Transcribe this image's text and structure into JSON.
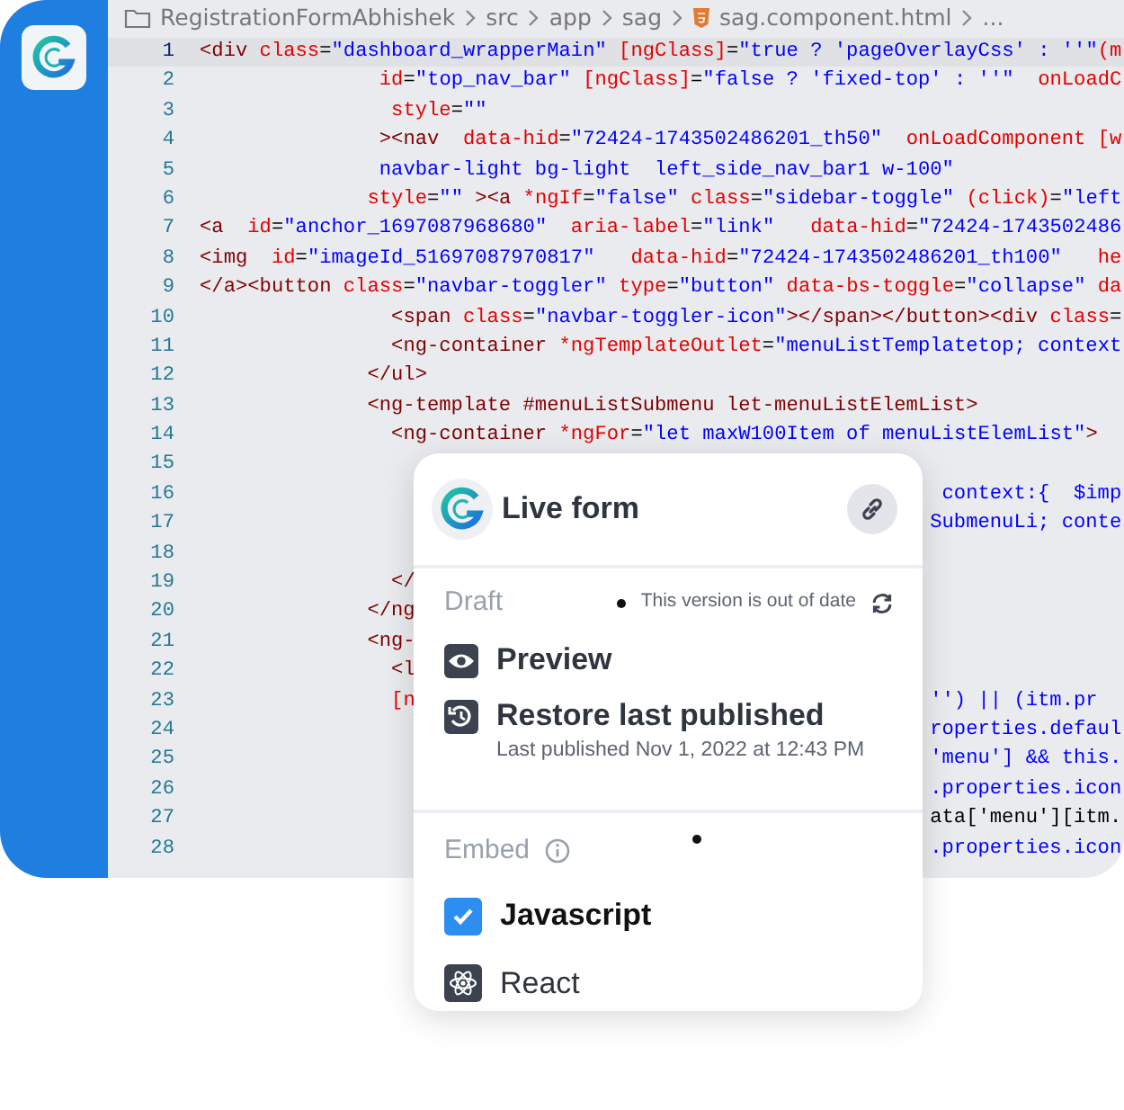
{
  "breadcrumb": [
    {
      "label": "RegistrationFormAbhishek",
      "kind": "folder"
    },
    {
      "label": "src"
    },
    {
      "label": "app"
    },
    {
      "label": "sag"
    },
    {
      "label": "sag.component.html",
      "kind": "html"
    },
    {
      "label": "..."
    }
  ],
  "editor": {
    "lines": [
      {
        "number": "1",
        "current": true,
        "tokens": [
          {
            "kind": "tag",
            "text": "<div "
          },
          {
            "kind": "attr",
            "text": "class"
          },
          {
            "kind": "plain",
            "text": "="
          },
          {
            "kind": "str",
            "text": "\"dashboard_wrapperMain\" "
          },
          {
            "kind": "attr",
            "text": "[ngClass]"
          },
          {
            "kind": "plain",
            "text": "="
          },
          {
            "kind": "str",
            "text": "\"true ? 'pageOverlayCss' : ''\""
          },
          {
            "kind": "attr",
            "text": "(m"
          }
        ]
      },
      {
        "number": "2",
        "current": false,
        "tokens": [
          {
            "kind": "attr",
            "text": "               id"
          },
          {
            "kind": "plain",
            "text": "="
          },
          {
            "kind": "str",
            "text": "\"top_nav_bar\" "
          },
          {
            "kind": "attr",
            "text": "[ngClass]"
          },
          {
            "kind": "plain",
            "text": "="
          },
          {
            "kind": "str",
            "text": "\"false ? 'fixed-top' : ''\"  "
          },
          {
            "kind": "attr",
            "text": "onLoadC"
          }
        ]
      },
      {
        "number": "3",
        "current": false,
        "tokens": [
          {
            "kind": "attr",
            "text": "                style"
          },
          {
            "kind": "plain",
            "text": "="
          },
          {
            "kind": "str",
            "text": "\"\""
          }
        ]
      },
      {
        "number": "4",
        "current": false,
        "tokens": [
          {
            "kind": "tag",
            "text": "               ><nav  "
          },
          {
            "kind": "attr",
            "text": "data-hid"
          },
          {
            "kind": "plain",
            "text": "="
          },
          {
            "kind": "str",
            "text": "\"72424-1743502486201_th50\"  "
          },
          {
            "kind": "attr",
            "text": "onLoadComponent [w"
          }
        ]
      },
      {
        "number": "5",
        "current": false,
        "tokens": [
          {
            "kind": "str",
            "text": "               navbar-light bg-light  left_side_nav_bar1 w-100\""
          }
        ]
      },
      {
        "number": "6",
        "current": false,
        "tokens": [
          {
            "kind": "attr",
            "text": "              style"
          },
          {
            "kind": "plain",
            "text": "="
          },
          {
            "kind": "str",
            "text": "\"\" "
          },
          {
            "kind": "tag",
            "text": "><a "
          },
          {
            "kind": "attr",
            "text": "*ngIf"
          },
          {
            "kind": "plain",
            "text": "="
          },
          {
            "kind": "str",
            "text": "\"false\" "
          },
          {
            "kind": "attr",
            "text": "class"
          },
          {
            "kind": "plain",
            "text": "="
          },
          {
            "kind": "str",
            "text": "\"sidebar-toggle\" "
          },
          {
            "kind": "attr",
            "text": "(click)"
          },
          {
            "kind": "plain",
            "text": "="
          },
          {
            "kind": "str",
            "text": "\"left"
          }
        ]
      },
      {
        "number": "7",
        "current": false,
        "tokens": [
          {
            "kind": "tag",
            "text": "<a  "
          },
          {
            "kind": "attr",
            "text": "id"
          },
          {
            "kind": "plain",
            "text": "="
          },
          {
            "kind": "str",
            "text": "\"anchor_1697087968680\"  "
          },
          {
            "kind": "attr",
            "text": "aria-label"
          },
          {
            "kind": "plain",
            "text": "="
          },
          {
            "kind": "str",
            "text": "\"link\"   "
          },
          {
            "kind": "attr",
            "text": "data-hid"
          },
          {
            "kind": "plain",
            "text": "="
          },
          {
            "kind": "str",
            "text": "\"72424-1743502486"
          }
        ]
      },
      {
        "number": "8",
        "current": false,
        "tokens": [
          {
            "kind": "tag",
            "text": "<img  "
          },
          {
            "kind": "attr",
            "text": "id"
          },
          {
            "kind": "plain",
            "text": "="
          },
          {
            "kind": "str",
            "text": "\"imageId_51697087970817\"   "
          },
          {
            "kind": "attr",
            "text": "data-hid"
          },
          {
            "kind": "plain",
            "text": "="
          },
          {
            "kind": "str",
            "text": "\"72424-1743502486201_th100\"   "
          },
          {
            "kind": "attr",
            "text": "he"
          }
        ]
      },
      {
        "number": "9",
        "current": false,
        "tokens": [
          {
            "kind": "tag",
            "text": "</a><button "
          },
          {
            "kind": "attr",
            "text": "class"
          },
          {
            "kind": "plain",
            "text": "="
          },
          {
            "kind": "str",
            "text": "\"navbar-toggler\" "
          },
          {
            "kind": "attr",
            "text": "type"
          },
          {
            "kind": "plain",
            "text": "="
          },
          {
            "kind": "str",
            "text": "\"button\" "
          },
          {
            "kind": "attr",
            "text": "data-bs-toggle"
          },
          {
            "kind": "plain",
            "text": "="
          },
          {
            "kind": "str",
            "text": "\"collapse\" "
          },
          {
            "kind": "attr",
            "text": "da"
          }
        ]
      },
      {
        "number": "10",
        "current": false,
        "tokens": [
          {
            "kind": "tag",
            "text": "                <span "
          },
          {
            "kind": "attr",
            "text": "class"
          },
          {
            "kind": "plain",
            "text": "="
          },
          {
            "kind": "str",
            "text": "\"navbar-toggler-icon\""
          },
          {
            "kind": "tag",
            "text": "></span></button><div "
          },
          {
            "kind": "attr",
            "text": "class"
          },
          {
            "kind": "plain",
            "text": "="
          }
        ]
      },
      {
        "number": "11",
        "current": false,
        "tokens": [
          {
            "kind": "tag",
            "text": "                <ng-container "
          },
          {
            "kind": "attr",
            "text": "*ngTemplateOutlet"
          },
          {
            "kind": "plain",
            "text": "="
          },
          {
            "kind": "str",
            "text": "\"menuListTemplatetop; context"
          }
        ]
      },
      {
        "number": "12",
        "current": false,
        "tokens": [
          {
            "kind": "tag",
            "text": "              </ul>"
          }
        ]
      },
      {
        "number": "13",
        "current": false,
        "tokens": [
          {
            "kind": "tag",
            "text": "              <ng-template #menuListSubmenu let-menuListElemList>"
          }
        ]
      },
      {
        "number": "14",
        "current": false,
        "tokens": [
          {
            "kind": "tag",
            "text": "                <ng-container "
          },
          {
            "kind": "attr",
            "text": "*ngFor"
          },
          {
            "kind": "plain",
            "text": "="
          },
          {
            "kind": "str",
            "text": "\"let maxW100Item of menuListElemList\""
          },
          {
            "kind": "tag",
            "text": ">"
          }
        ]
      },
      {
        "number": "15",
        "current": false
      },
      {
        "number": "16",
        "current": false,
        "right": [
          {
            "kind": "str",
            "text": " context:{  $imp"
          }
        ]
      },
      {
        "number": "17",
        "current": false,
        "right": [
          {
            "kind": "str",
            "text": "SubmenuLi; conte"
          }
        ]
      },
      {
        "number": "18",
        "current": false
      },
      {
        "number": "19",
        "current": false,
        "tokens": [
          {
            "kind": "tag",
            "text": "                </"
          }
        ]
      },
      {
        "number": "20",
        "current": false,
        "tokens": [
          {
            "kind": "tag",
            "text": "              </ng"
          }
        ]
      },
      {
        "number": "21",
        "current": false,
        "tokens": [
          {
            "kind": "tag",
            "text": "              <ng-"
          }
        ]
      },
      {
        "number": "22",
        "current": false,
        "tokens": [
          {
            "kind": "tag",
            "text": "                <l"
          }
        ]
      },
      {
        "number": "23",
        "current": false,
        "tokens": [
          {
            "kind": "attr",
            "text": "                [n"
          }
        ],
        "right": [
          {
            "kind": "str",
            "text": "'') || (itm.pr"
          }
        ]
      },
      {
        "number": "24",
        "current": false,
        "right": [
          {
            "kind": "str",
            "text": "roperties.defaul"
          }
        ]
      },
      {
        "number": "25",
        "current": false,
        "right": [
          {
            "kind": "str",
            "text": "'menu'] && this."
          }
        ]
      },
      {
        "number": "26",
        "current": false,
        "right": [
          {
            "kind": "str",
            "text": ".properties.icon"
          }
        ]
      },
      {
        "number": "27",
        "current": false,
        "right": [
          {
            "kind": "plain",
            "text": "ata['menu'][itm."
          }
        ]
      },
      {
        "number": "28",
        "current": false,
        "right": [
          {
            "kind": "str",
            "text": ".properties.icon"
          }
        ]
      }
    ]
  },
  "popup": {
    "title": "Live form",
    "draft": {
      "label": "Draft",
      "status": "This version is out of date"
    },
    "actions": [
      {
        "label": "Preview",
        "kind": "preview"
      },
      {
        "label": "Restore last published",
        "kind": "restore",
        "subtitle": "Last published Nov 1, 2022 at 12:43 PM"
      }
    ],
    "embed": {
      "label": "Embed",
      "options": [
        {
          "label": "Javascript",
          "kind": "checkbox",
          "checked": true
        },
        {
          "label": "React",
          "kind": "react"
        }
      ]
    }
  }
}
